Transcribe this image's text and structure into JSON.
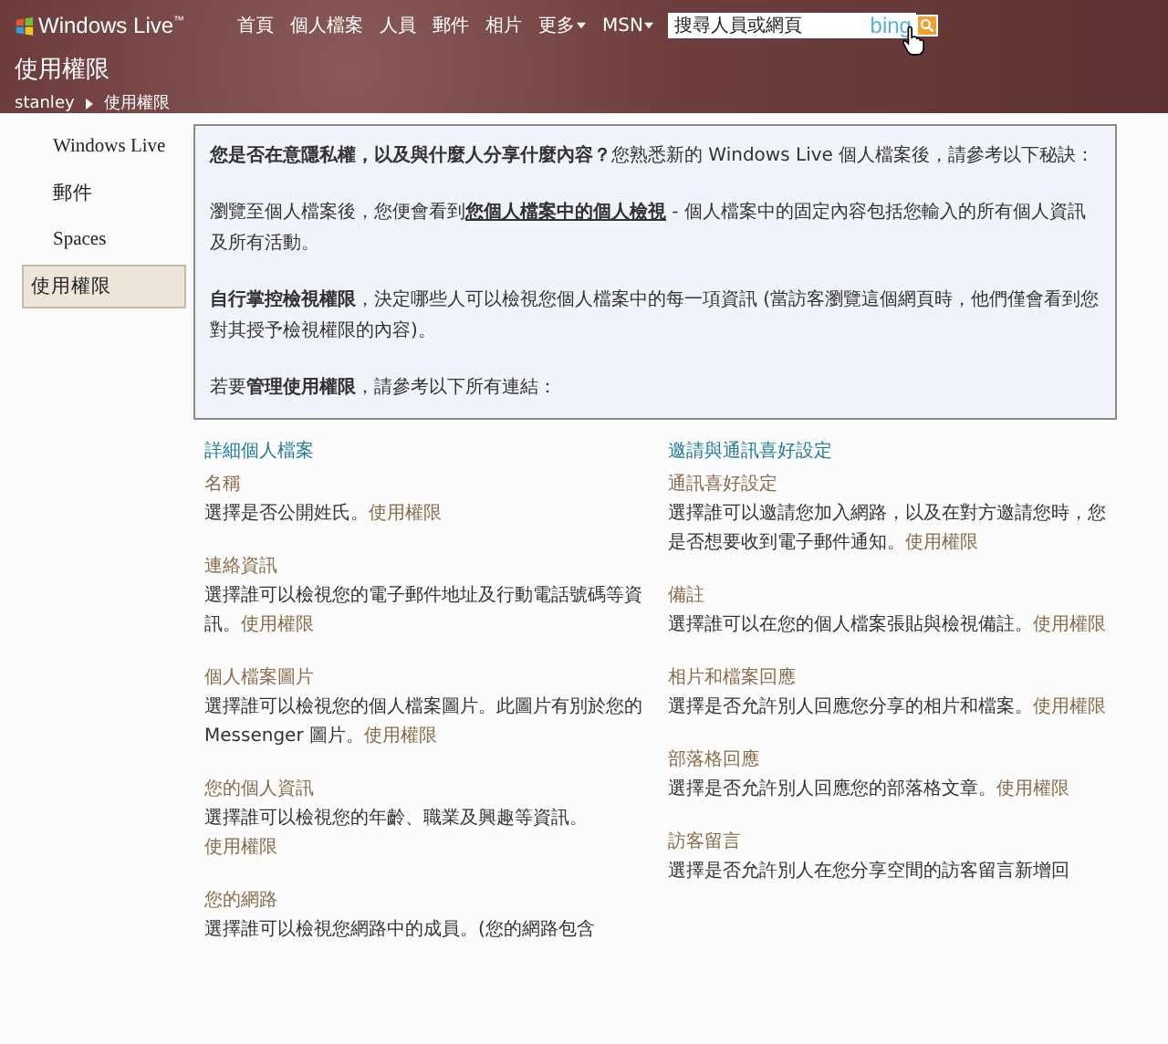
{
  "header": {
    "logo": "Windows Live",
    "logo_mark": "™",
    "nav": [
      {
        "label": "首頁",
        "dropdown": false
      },
      {
        "label": "個人檔案",
        "dropdown": false
      },
      {
        "label": "人員",
        "dropdown": false
      },
      {
        "label": "郵件",
        "dropdown": false
      },
      {
        "label": "相片",
        "dropdown": false
      },
      {
        "label": "更多",
        "dropdown": true
      },
      {
        "label": "MSN",
        "dropdown": true
      }
    ],
    "search": {
      "placeholder": "搜尋人員或網頁",
      "brand": "bing"
    },
    "title": "使用權限",
    "breadcrumb": [
      "stanley",
      "使用權限"
    ]
  },
  "sidebar": {
    "items": [
      {
        "label": "Windows Live",
        "selected": false
      },
      {
        "label": "郵件",
        "selected": false
      },
      {
        "label": "Spaces",
        "selected": false
      },
      {
        "label": "使用權限",
        "selected": true
      }
    ]
  },
  "intro": {
    "paragraphs": [
      {
        "before": "**您是否在意隱私權，以及與什麼人分享什麼內容？**您熟悉新的 Windows Live 個人檔案後，請參考以下秘訣："
      },
      {
        "before": "瀏覽至個人檔案後，您便會看到",
        "link": "您個人檔案中的個人檢視",
        "after": " - 個人檔案中的固定內容包括您輸入的所有個人資訊及所有活動。"
      },
      {
        "before": "**自行掌控檢視權限**，決定哪些人可以檢視您個人檔案中的每一項資訊 (當訪客瀏覽這個網頁時，他們僅會看到您對其授予檢視權限的內容)。"
      },
      {
        "before": "若要**管理使用權限**，請參考以下所有連結："
      }
    ]
  },
  "sections": [
    {
      "heading": "詳細個人檔案",
      "items": [
        {
          "title": "名稱",
          "text": "選擇是否公開姓氏。",
          "link": "使用權限"
        },
        {
          "title": "連絡資訊",
          "text": "選擇誰可以檢視您的電子郵件地址及行動電話號碼等資訊。",
          "link": "使用權限"
        },
        {
          "title": "個人檔案圖片",
          "text": "選擇誰可以檢視您的個人檔案圖片。此圖片有別於您的 Messenger 圖片。",
          "link": "使用權限"
        },
        {
          "title": "您的個人資訊",
          "text": "選擇誰可以檢視您的年齡、職業及興趣等資訊。",
          "link": "使用權限"
        },
        {
          "title": "您的網路",
          "text": "選擇誰可以檢視您網路中的成員。(您的網路包含"
        }
      ]
    },
    {
      "heading": "邀請與通訊喜好設定",
      "items": [
        {
          "title": "通訊喜好設定",
          "text": "選擇誰可以邀請您加入網路，以及在對方邀請您時，您是否想要收到電子郵件通知。",
          "link": "使用權限"
        },
        {
          "title": "備註",
          "text": "選擇誰可以在您的個人檔案張貼與檢視備註。",
          "link": "使用權限"
        },
        {
          "title": "相片和檔案回應",
          "text": "選擇是否允許別人回應您分享的相片和檔案。",
          "link": "使用權限"
        },
        {
          "title": "部落格回應",
          "text": "選擇是否允許別人回應您的部落格文章。",
          "link": "使用權限"
        },
        {
          "title": "訪客留言",
          "text": "選擇是否允許別人在您分享空間的訪客留言新增回"
        }
      ]
    }
  ]
}
